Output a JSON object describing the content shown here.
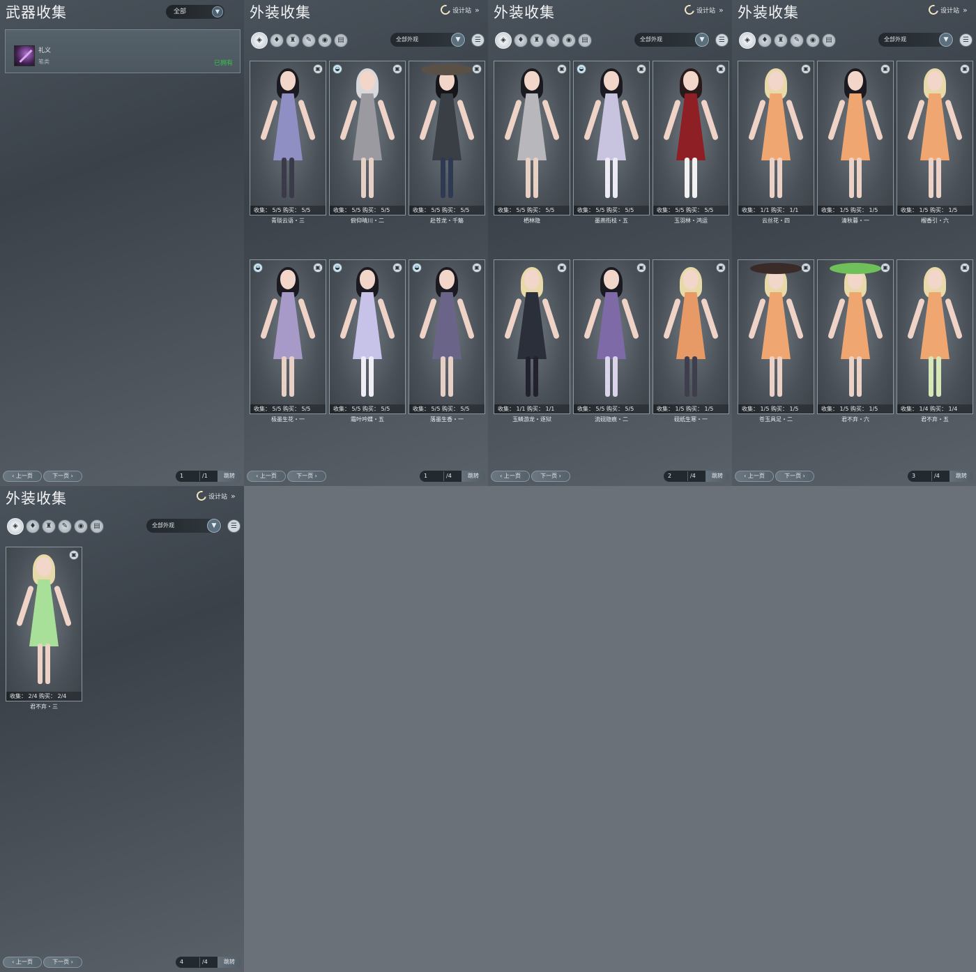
{
  "weapon_panel": {
    "title": "武器收集",
    "filter": "全部",
    "item": {
      "name": "礼义",
      "type": "笔类",
      "status": "已拥有"
    },
    "pager": {
      "prev": "上一页",
      "next": "下一页",
      "page": "1",
      "total": "/1",
      "jump": "跳转"
    }
  },
  "outfit_panels": [
    {
      "title": "外装收集",
      "designer": "设计站",
      "filter": "全部外观",
      "pager": {
        "prev": "上一页",
        "next": "下一页",
        "page": "1",
        "total": "/4",
        "jump": "跳转"
      },
      "cards": [
        {
          "name": "青琰云语・三",
          "stats": "收集：  5/5    购买：  5/5",
          "hair": "#1b1a20",
          "outfit": "#8f8fc4",
          "legs": "#3a3a48",
          "badge_left": false
        },
        {
          "name": "俯仰晴川・二",
          "stats": "收集：  5/5    购买：  5/5",
          "hair": "#d8d8dc",
          "outfit": "#9a9aa0",
          "legs": "#e6cfc4",
          "badge_left": true
        },
        {
          "name": "赴苍龙・千觞",
          "stats": "收集：  5/5    购买：  5/5",
          "hair": "#15151a",
          "outfit": "#3a3e45",
          "legs": "#2e3a52",
          "badge_left": false,
          "hat": "#5a5046"
        },
        {
          "name": "极墨生花・一",
          "stats": "收集：  5/5    购买：  5/5",
          "hair": "#1b1a20",
          "outfit": "#a89ac8",
          "legs": "#e9d0c4",
          "badge_left": true
        },
        {
          "name": "霜叶吟蝶・五",
          "stats": "收集：  5/5    购买：  5/5",
          "hair": "#1b1a20",
          "outfit": "#c7c2e8",
          "legs": "#f0eef5",
          "badge_left": true
        },
        {
          "name": "落墨生香・一",
          "stats": "收集：  5/5    购买：  5/5",
          "hair": "#1b1a20",
          "outfit": "#6a6488",
          "legs": "#e6cfc4",
          "badge_left": true
        }
      ]
    },
    {
      "title": "外装收集",
      "designer": "设计站",
      "filter": "全部外观",
      "pager": {
        "prev": "上一页",
        "next": "下一页",
        "page": "2",
        "total": "/4",
        "jump": "跳转"
      },
      "cards": [
        {
          "name": "栖林隐",
          "stats": "收集：  5/5    购买：  5/5",
          "hair": "#1b1a20",
          "outfit": "#b8b8bc",
          "legs": "#e9d0c4",
          "badge_left": false
        },
        {
          "name": "墨燕衔枝・五",
          "stats": "收集：  5/5    购买：  5/5",
          "hair": "#1b1a20",
          "outfit": "#c8c4e0",
          "legs": "#eceaf2",
          "badge_left": true
        },
        {
          "name": "玉羽林・鸿运",
          "stats": "收集：  5/5    购买：  5/5",
          "hair": "#2a1a1a",
          "outfit": "#8e2025",
          "legs": "#f1f1f1",
          "badge_left": false
        },
        {
          "name": "玉鳞游龙・逐狱",
          "stats": "收集：  1/1    购买：  1/1",
          "hair": "#e8d9a8",
          "outfit": "#2a2f3a",
          "legs": "#22222e",
          "badge_left": false
        },
        {
          "name": "流砚隐痕・二",
          "stats": "收集：  5/5    购买：  5/5",
          "hair": "#1b1a20",
          "outfit": "#7e6aa6",
          "legs": "#d9d4ea",
          "badge_left": false
        },
        {
          "name": "砚纸生寒・一",
          "stats": "收集：  1/5    购买：  1/5",
          "hair": "#e8d9a8",
          "outfit": "#e89a66",
          "legs": "#3e3e4c",
          "badge_left": false
        }
      ]
    },
    {
      "title": "外装收集",
      "designer": "设计站",
      "filter": "全部外观",
      "pager": {
        "prev": "上一页",
        "next": "下一页",
        "page": "3",
        "total": "/4",
        "jump": "跳转"
      },
      "cards": [
        {
          "name": "云丝花・四",
          "stats": "收集：  1/1    购买：  1/1",
          "hair": "#e8d9a8",
          "outfit": "#f0a670",
          "legs": "#ecd2c6",
          "badge_left": false
        },
        {
          "name": "清秋暮・一",
          "stats": "收集：  1/5    购买：  1/5",
          "hair": "#1b1a20",
          "outfit": "#f0a670",
          "legs": "#ecd2c6",
          "badge_left": false
        },
        {
          "name": "榴香引・六",
          "stats": "收集：  1/5    购买：  1/5",
          "hair": "#e8d9a8",
          "outfit": "#f0a670",
          "legs": "#ecd2c6",
          "badge_left": false
        },
        {
          "name": "苍玉具足・二",
          "stats": "收集：  1/5    购买：  1/5",
          "hair": "#e8d9a8",
          "outfit": "#f0a670",
          "legs": "#ecd2c6",
          "badge_left": false,
          "hat": "#3a2a28"
        },
        {
          "name": "君不弃・六",
          "stats": "收集：  1/5    购买：  1/5",
          "hair": "#e8d9a8",
          "outfit": "#f0a670",
          "legs": "#ecd2c6",
          "badge_left": false,
          "hat": "#6fc05a"
        },
        {
          "name": "君不弃・五",
          "stats": "收集：  1/4    购买：  1/4",
          "hair": "#e8d9a8",
          "outfit": "#f0a670",
          "legs": "#d6e8b8",
          "badge_left": false
        }
      ]
    },
    {
      "title": "外装收集",
      "designer": "设计站",
      "filter": "全部外观",
      "pager": {
        "prev": "上一页",
        "next": "下一页",
        "page": "4",
        "total": "/4",
        "jump": "跳转"
      },
      "cards": [
        {
          "name": "君不弃・三",
          "stats": "收集：  2/4    购买：  2/4",
          "hair": "#e8d9a8",
          "outfit": "#a8e09a",
          "legs": "#ecd2c6",
          "badge_left": false
        }
      ]
    }
  ],
  "category_icons": [
    "all-outfits-icon",
    "top-icon",
    "dress-icon",
    "feather-icon",
    "mask-icon",
    "scroll-icon"
  ]
}
